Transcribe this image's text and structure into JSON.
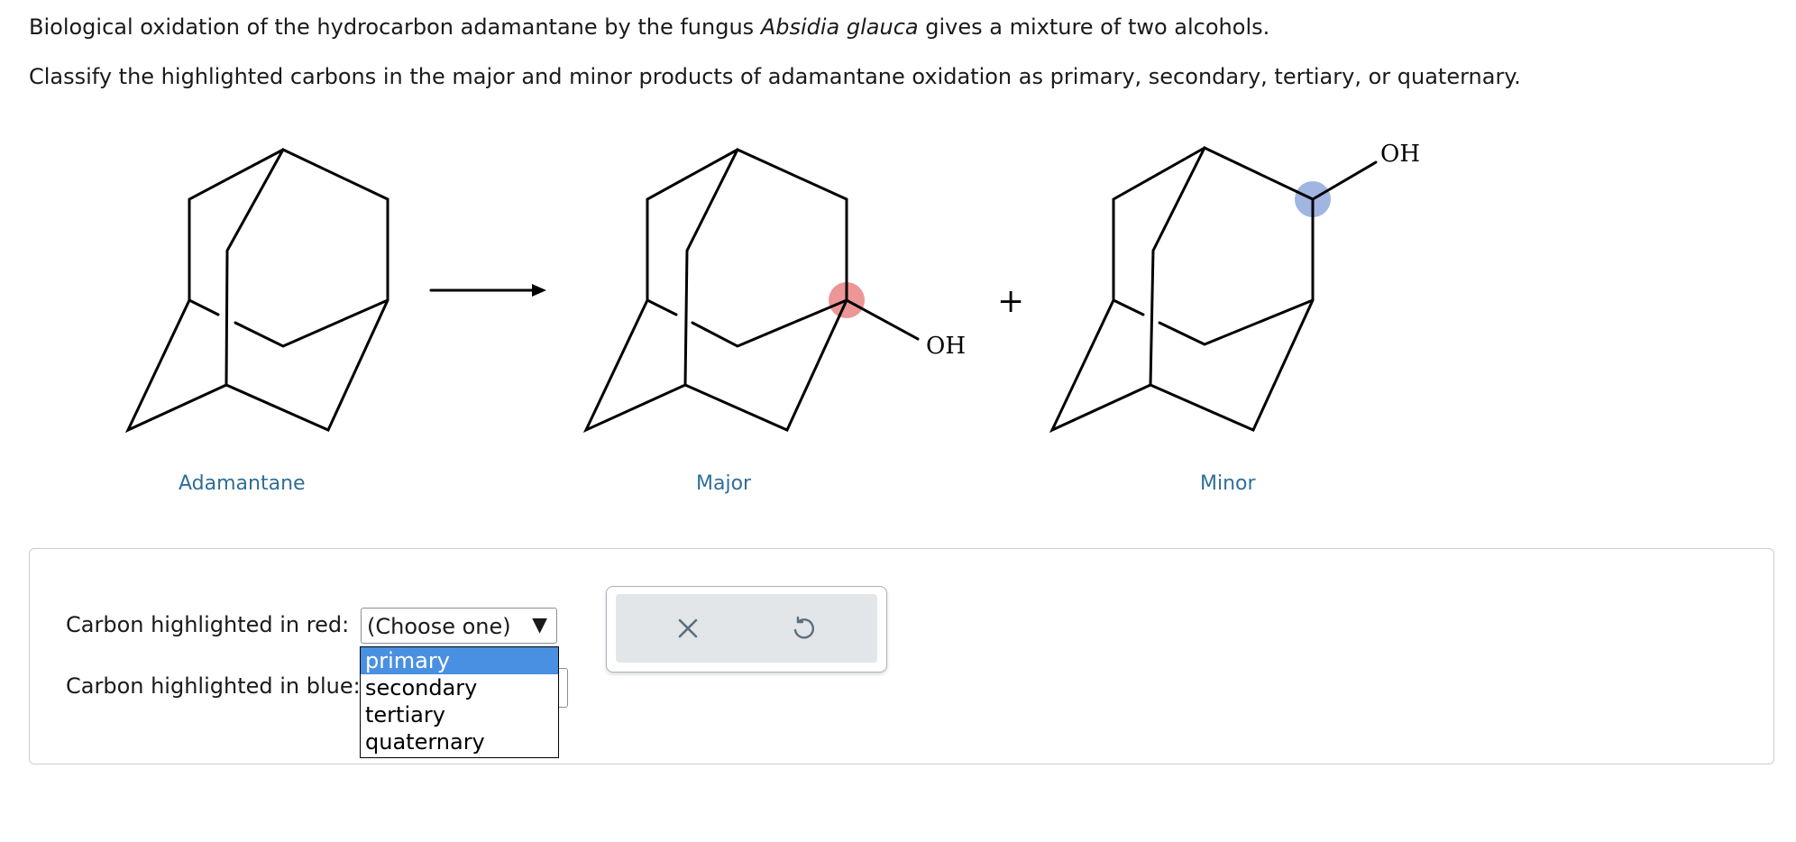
{
  "question": {
    "line1_pre": "Biological oxidation of the hydrocarbon adamantane by the fungus ",
    "line1_italic": "Absidia glauca",
    "line1_post": " gives a mixture of two alcohols.",
    "line2": "Classify the highlighted carbons in the major and minor products of adamantane oxidation as primary, secondary, tertiary, or quaternary."
  },
  "scheme": {
    "oh_major": "OH",
    "oh_minor": "OH",
    "plus": "+",
    "label_adamantane": "Adamantane",
    "label_major": "Major",
    "label_minor": "Minor",
    "highlight_red": "#e57373",
    "highlight_blue": "#8fa9dc"
  },
  "form": {
    "red_label": "Carbon highlighted in red:",
    "blue_label": "Carbon highlighted in blue:",
    "red_select_value": "(Choose one)",
    "dropdown_options": [
      "primary",
      "secondary",
      "tertiary",
      "quaternary"
    ],
    "dropdown_highlighted": "primary"
  },
  "toolbar": {
    "clear_icon": "x-icon",
    "undo_icon": "undo-icon"
  }
}
